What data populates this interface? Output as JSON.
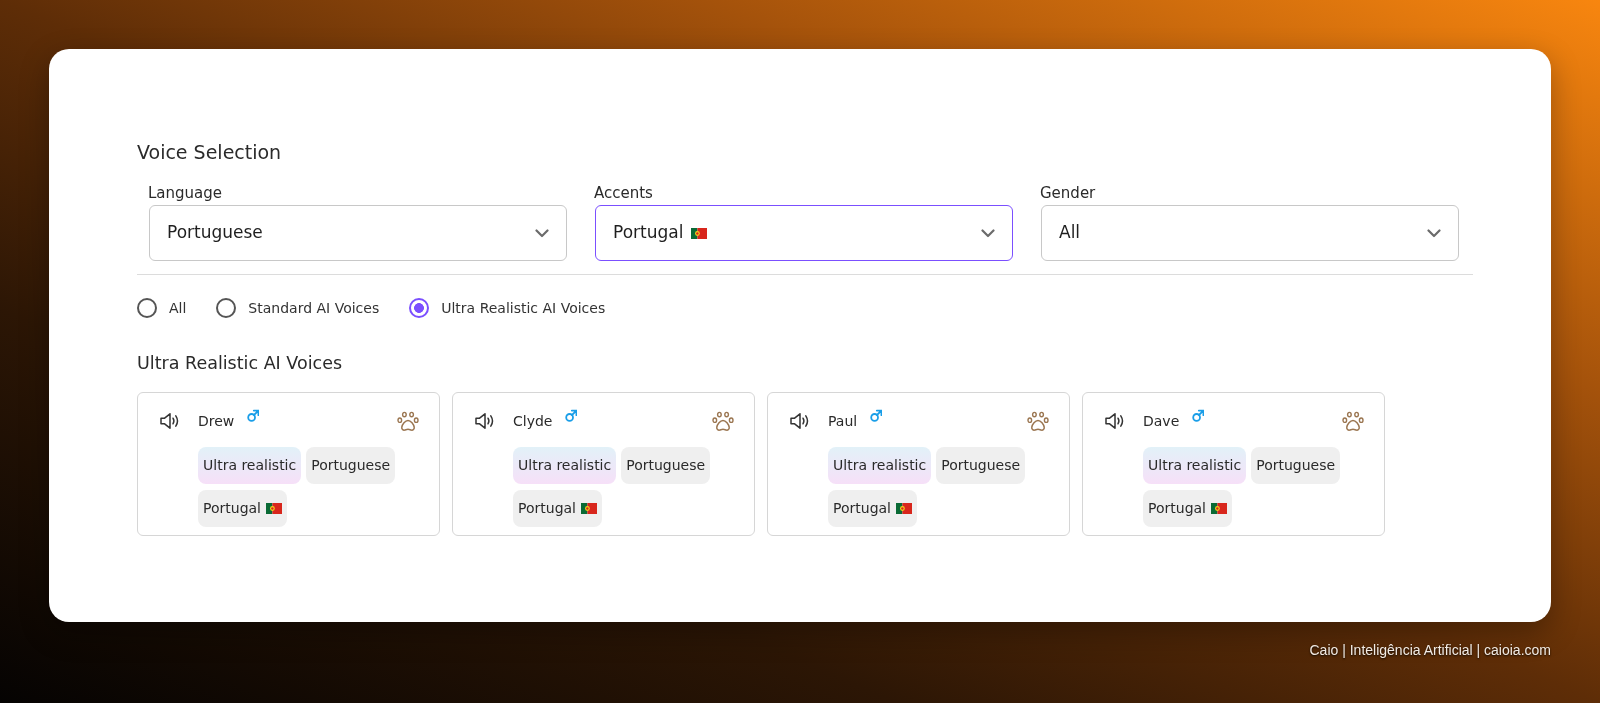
{
  "panel": {
    "title": "Voice Selection",
    "filters": [
      {
        "kind": "language",
        "label": "Language",
        "value": "Portuguese",
        "focused": false
      },
      {
        "kind": "accent",
        "label": "Accents",
        "value": "Portugal",
        "focused": true
      },
      {
        "kind": "gender",
        "label": "Gender",
        "value": "All",
        "focused": false
      }
    ],
    "voice_types": [
      {
        "label": "All",
        "selected": false
      },
      {
        "label": "Standard AI Voices",
        "selected": false
      },
      {
        "label": "Ultra Realistic AI Voices",
        "selected": true
      }
    ],
    "section_title": "Ultra Realistic AI Voices",
    "voices": [
      {
        "name": "Drew",
        "tags": [
          {
            "kind": "quality",
            "label": "Ultra realistic"
          },
          {
            "kind": "language",
            "label": "Portuguese"
          },
          {
            "kind": "accent",
            "label": "Portugal"
          }
        ]
      },
      {
        "name": "Clyde",
        "tags": [
          {
            "kind": "quality",
            "label": "Ultra realistic"
          },
          {
            "kind": "language",
            "label": "Portuguese"
          },
          {
            "kind": "accent",
            "label": "Portugal"
          }
        ]
      },
      {
        "name": "Paul",
        "tags": [
          {
            "kind": "quality",
            "label": "Ultra realistic"
          },
          {
            "kind": "language",
            "label": "Portuguese"
          },
          {
            "kind": "accent",
            "label": "Portugal"
          }
        ]
      },
      {
        "name": "Dave",
        "tags": [
          {
            "kind": "quality",
            "label": "Ultra realistic"
          },
          {
            "kind": "language",
            "label": "Portuguese"
          },
          {
            "kind": "accent",
            "label": "Portugal"
          }
        ]
      }
    ]
  },
  "credit": "Caio | Inteligência Artificial | caioia.com"
}
